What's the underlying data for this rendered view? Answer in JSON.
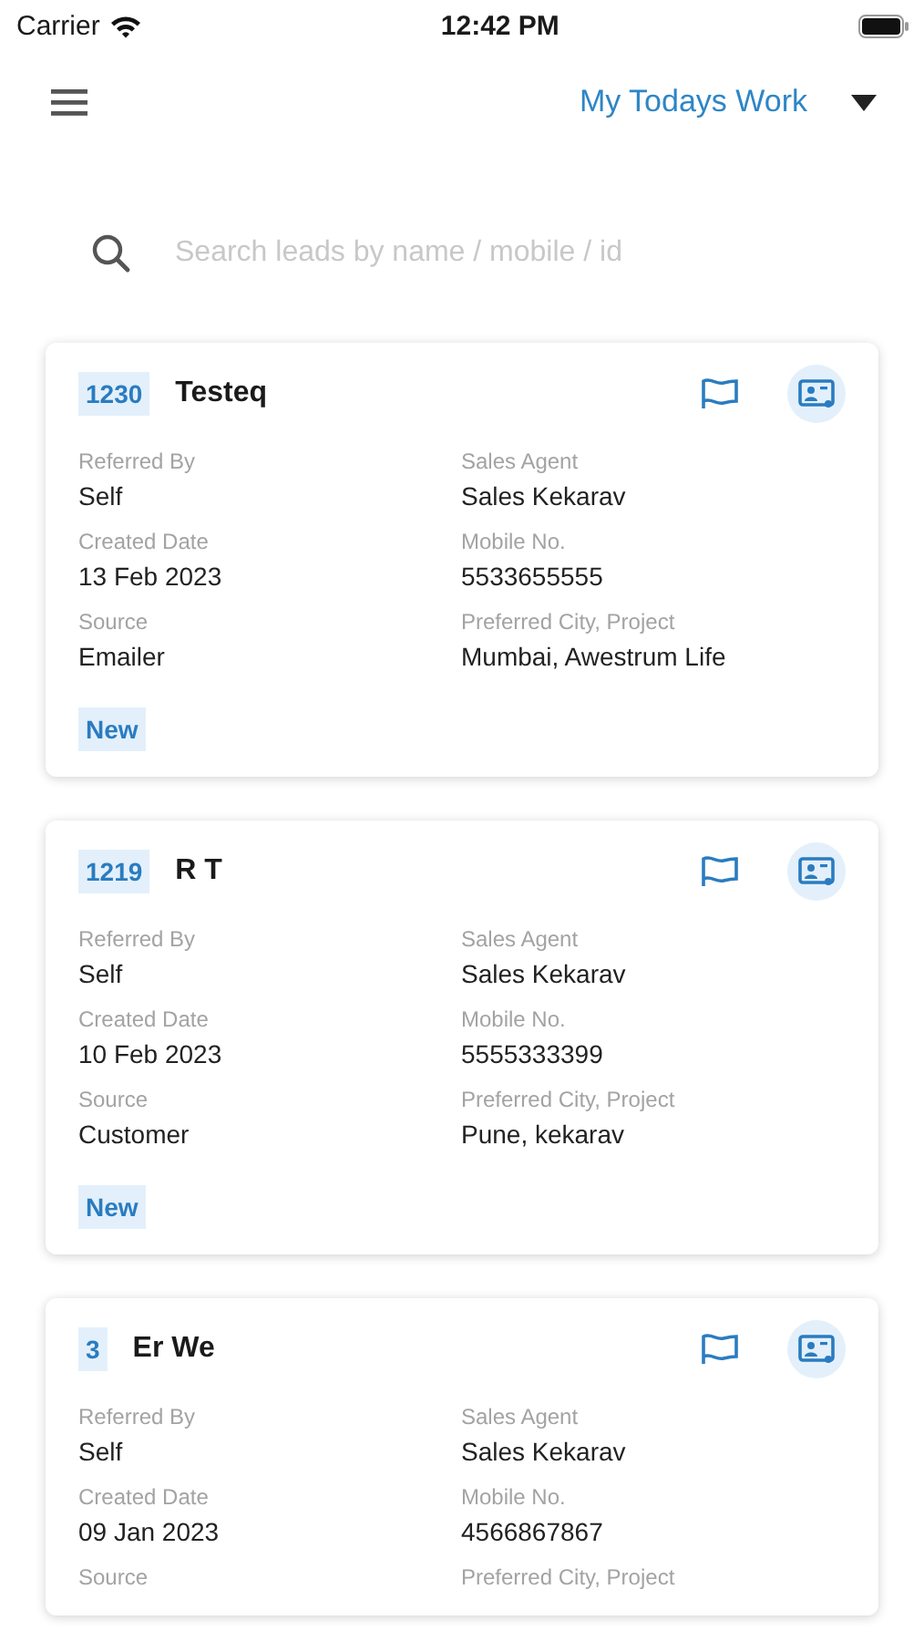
{
  "status_bar": {
    "carrier": "Carrier",
    "time": "12:42 PM"
  },
  "header": {
    "filter": "My Todays Work"
  },
  "search": {
    "placeholder": "Search leads by name / mobile / id"
  },
  "leads": [
    {
      "id": "1230",
      "name": "Testeq",
      "fields": [
        {
          "label": "Referred By",
          "value": "Self"
        },
        {
          "label": "Sales Agent",
          "value": "Sales Kekarav"
        },
        {
          "label": "Created Date",
          "value": "13 Feb 2023"
        },
        {
          "label": "Mobile No.",
          "value": "5533655555"
        },
        {
          "label": "Source",
          "value": "Emailer"
        },
        {
          "label": "Preferred City, Project",
          "value": "Mumbai, Awestrum Life"
        }
      ],
      "status": "New"
    },
    {
      "id": "1219",
      "name": "R T",
      "fields": [
        {
          "label": "Referred By",
          "value": "Self"
        },
        {
          "label": "Sales Agent",
          "value": "Sales Kekarav"
        },
        {
          "label": "Created Date",
          "value": "10 Feb 2023"
        },
        {
          "label": "Mobile No.",
          "value": "5555333399"
        },
        {
          "label": "Source",
          "value": "Customer"
        },
        {
          "label": "Preferred City, Project",
          "value": "Pune, kekarav"
        }
      ],
      "status": "New"
    },
    {
      "id": "3",
      "name": "Er We",
      "fields": [
        {
          "label": "Referred By",
          "value": "Self"
        },
        {
          "label": "Sales Agent",
          "value": "Sales Kekarav"
        },
        {
          "label": "Created Date",
          "value": "09 Jan 2023"
        },
        {
          "label": "Mobile No.",
          "value": "4566867867"
        },
        {
          "label": "Source"
        },
        {
          "label": "Preferred City, Project"
        }
      ]
    }
  ]
}
